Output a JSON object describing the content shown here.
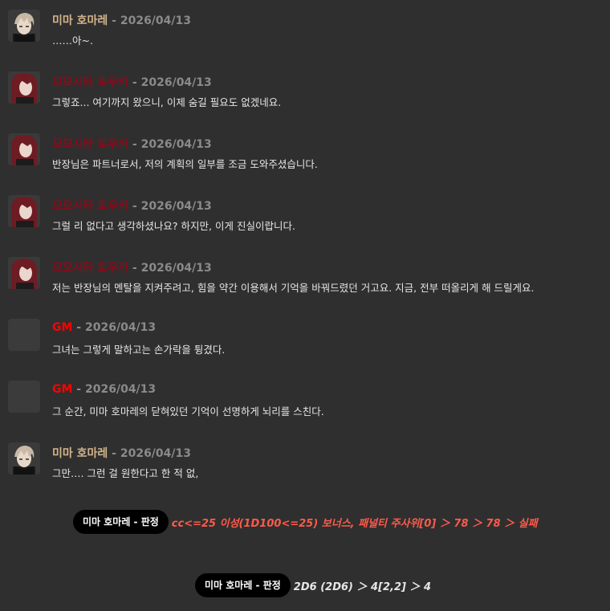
{
  "messages": [
    {
      "name": "미마 호마레",
      "date": "2026/04/13",
      "text": "……아~."
    },
    {
      "name": "모모시타 토우카",
      "date": "2026/04/13",
      "text": "그렇죠... 여기까지 왔으니, 이제 숨길 필요도 없겠네요."
    },
    {
      "name": "모모시타 토우카",
      "date": "2026/04/13",
      "text": "반장님은 파트너로서, 저의 계획의 일부를 조금 도와주셨습니다."
    },
    {
      "name": "모모시타 토우카",
      "date": "2026/04/13",
      "text": "그럴 리 없다고 생각하셨나요? 하지만, 이게 진실이랍니다."
    },
    {
      "name": "모모시타 토우카",
      "date": "2026/04/13",
      "text": "저는 반장님의 멘탈을 지켜주려고, 힘을 약간 이용해서 기억을 바꿔드렸던 거고요. 지금, 전부 떠올리게 해 드릴게요."
    },
    {
      "name": "GM",
      "date": "2026/04/13",
      "text": "그녀는 그렇게 말하고는 손가락을 튕겼다."
    },
    {
      "name": "GM",
      "date": "2026/04/13",
      "text": "그 순간, 미마 호마레의 닫혀있던 기억이 선명하게 뇌리를 스친다."
    },
    {
      "name": "미마 호마레",
      "date": "2026/04/13",
      "text": "그만…. 그런 걸 원한다고 한 적 없,"
    }
  ],
  "separator": " - ",
  "rolls": [
    {
      "label": "미마 호마레 - 판정",
      "result": "cc<=25 이성(1D100<=25) 보너스, 패널티 주사위[0] ＞ 78 ＞ 78 ＞ 실패"
    },
    {
      "label": "미마 호마레 - 판정",
      "result": "2D6 (2D6) ＞ 4[2,2] ＞ 4"
    }
  ],
  "colors": {
    "mima": "#d2b48c",
    "touka": "#8b0a1a",
    "gm": "#ff0000",
    "fail": "#ff5a4a"
  }
}
